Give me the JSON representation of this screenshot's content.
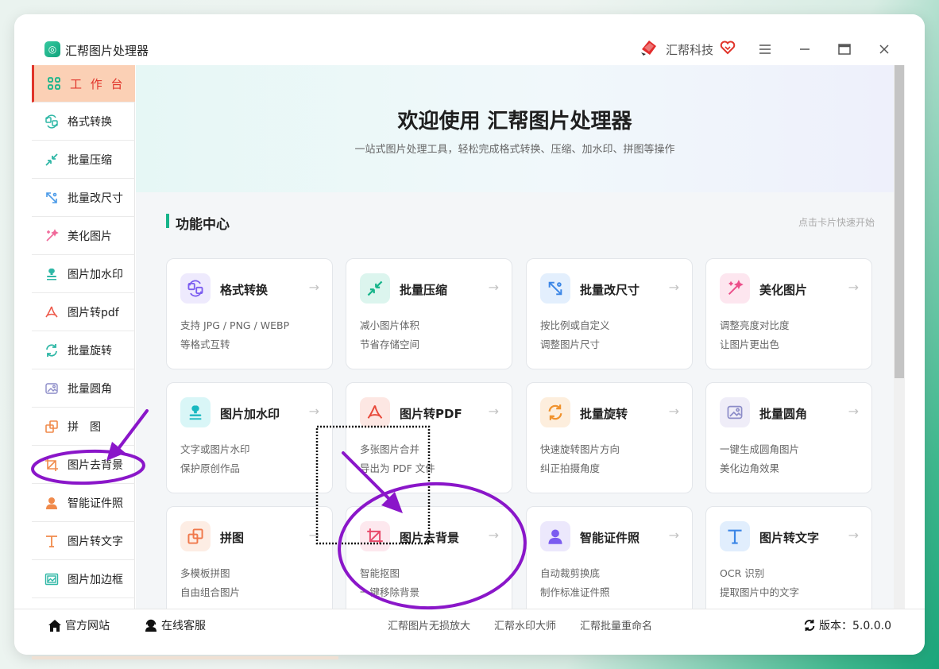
{
  "app": {
    "title": "汇帮图片处理器",
    "brand": "汇帮科技"
  },
  "sidebar": {
    "items": [
      {
        "label": "工 作 台",
        "icon": "grid-icon",
        "active": true
      },
      {
        "label": "格式转换",
        "icon": "format-convert-icon"
      },
      {
        "label": "批量压缩",
        "icon": "compress-icon"
      },
      {
        "label": "批量改尺寸",
        "icon": "resize-icon"
      },
      {
        "label": "美化图片",
        "icon": "beautify-icon"
      },
      {
        "label": "图片加水印",
        "icon": "watermark-icon"
      },
      {
        "label": "图片转pdf",
        "icon": "pdf-icon"
      },
      {
        "label": "批量旋转",
        "icon": "rotate-icon"
      },
      {
        "label": "批量圆角",
        "icon": "round-corner-icon"
      },
      {
        "label": "拼　图",
        "icon": "puzzle-icon"
      },
      {
        "label": "图片去背景",
        "icon": "crop-icon"
      },
      {
        "label": "智能证件照",
        "icon": "person-icon"
      },
      {
        "label": "图片转文字",
        "icon": "text-icon"
      },
      {
        "label": "图片加边框",
        "icon": "border-icon"
      }
    ]
  },
  "hero": {
    "title": "欢迎使用 汇帮图片处理器",
    "subtitle": "一站式图片处理工具，轻松完成格式转换、压缩、加水印、拼图等操作"
  },
  "section": {
    "title": "功能中心",
    "hint": "点击卡片快速开始"
  },
  "cards": [
    {
      "title": "格式转换",
      "line1": "支持 JPG / PNG / WEBP",
      "line2": "等格式互转",
      "icon": "format-convert-icon",
      "arrow": "→"
    },
    {
      "title": "批量压缩",
      "line1": "减小图片体积",
      "line2": "节省存储空间",
      "icon": "compress-icon",
      "arrow": "→"
    },
    {
      "title": "批量改尺寸",
      "line1": "按比例或自定义",
      "line2": "调整图片尺寸",
      "icon": "resize-icon",
      "arrow": "→"
    },
    {
      "title": "美化图片",
      "line1": "调整亮度对比度",
      "line2": "让图片更出色",
      "icon": "beautify-icon",
      "arrow": "→"
    },
    {
      "title": "图片加水印",
      "line1": "文字或图片水印",
      "line2": "保护原创作品",
      "icon": "watermark-icon",
      "arrow": "→"
    },
    {
      "title": "图片转PDF",
      "line1": "多张图片合并",
      "line2": "导出为 PDF 文件",
      "icon": "pdf-icon",
      "arrow": "→"
    },
    {
      "title": "批量旋转",
      "line1": "快速旋转图片方向",
      "line2": "纠正拍摄角度",
      "icon": "rotate-icon",
      "arrow": "→"
    },
    {
      "title": "批量圆角",
      "line1": "一键生成圆角图片",
      "line2": "美化边角效果",
      "icon": "round-corner-icon",
      "arrow": "→"
    },
    {
      "title": "拼图",
      "line1": "多模板拼图",
      "line2": "自由组合图片",
      "icon": "puzzle-icon",
      "arrow": "→"
    },
    {
      "title": "图片去背景",
      "line1": "智能抠图",
      "line2": "一键移除背景",
      "icon": "crop-icon",
      "arrow": "→"
    },
    {
      "title": "智能证件照",
      "line1": "自动裁剪换底",
      "line2": "制作标准证件照",
      "icon": "person-icon",
      "arrow": "→"
    },
    {
      "title": "图片转文字",
      "line1": "OCR 识别",
      "line2": "提取图片中的文字",
      "icon": "text-icon",
      "arrow": "→"
    }
  ],
  "footer": {
    "website": "官方网站",
    "support": "在线客服",
    "links": [
      "汇帮图片无损放大",
      "汇帮水印大师",
      "汇帮批量重命名"
    ],
    "version": "版本：5.0.0.0"
  },
  "colors": {
    "accent": "#17b48a",
    "active_bg": "#fbd0b5",
    "active_text": "#e0342a",
    "annotation": "#8a16c9"
  }
}
